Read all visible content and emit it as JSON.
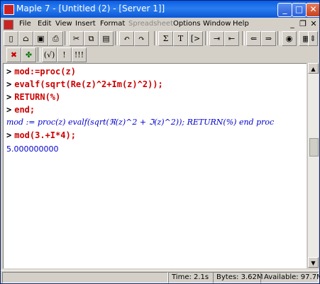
{
  "window": {
    "title": "Maple 7 - [Untitled (2) - [Server 1]]"
  },
  "menu": {
    "items": [
      "File",
      "Edit",
      "View",
      "Insert",
      "Format",
      "Spreadsheet",
      "Options",
      "Window",
      "Help"
    ],
    "disabled": [
      "Spreadsheet"
    ]
  },
  "toolbar1": {
    "icons": [
      "new-icon",
      "open-icon",
      "save-icon",
      "print-icon",
      "cut-icon",
      "copy-icon",
      "paste-icon",
      "undo-icon",
      "redo-icon",
      "sum-icon",
      "text-icon",
      "prompt-icon",
      "indent-icon",
      "back-icon",
      "forward-icon",
      "stop-icon",
      "zoom-icon",
      "scroll-icon"
    ]
  },
  "toolbar2": {
    "buttons": [
      "x",
      "plus",
      "(√)",
      "!",
      "!!!"
    ]
  },
  "worksheet": {
    "prompt": ">",
    "lines": [
      {
        "kind": "input",
        "text": "mod:=proc(z)"
      },
      {
        "kind": "input",
        "text": "evalf(sqrt(Re(z)^2+Im(z)^2));"
      },
      {
        "kind": "input",
        "text": "RETURN(%)"
      },
      {
        "kind": "input",
        "text": "end;"
      },
      {
        "kind": "output",
        "text": "mod := proc(z) evalf(sqrt(ℜ(z)^2 + ℑ(z)^2)); RETURN(%) end proc"
      },
      {
        "kind": "input",
        "text": "mod(3.+I*4);"
      },
      {
        "kind": "result",
        "text": "5.000000000"
      }
    ]
  },
  "status": {
    "time": "Time:  2.1s",
    "bytes": "Bytes: 3.62M",
    "available": "Available: 97.7M"
  }
}
